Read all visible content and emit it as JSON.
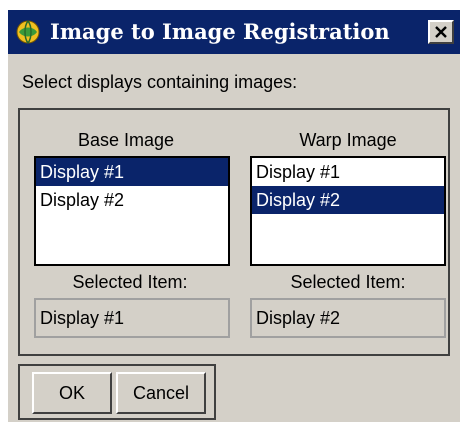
{
  "window": {
    "title": "Image to Image Registration",
    "app_icon": "globe-icon",
    "close_icon": "close-icon"
  },
  "prompt": "Select displays containing images:",
  "base": {
    "label": "Base Image",
    "items": [
      "Display #1",
      "Display #2"
    ],
    "selected_index": 0,
    "selected_label": "Selected Item:",
    "selected_value": "Display #1"
  },
  "warp": {
    "label": "Warp Image",
    "items": [
      "Display #1",
      "Display #2"
    ],
    "selected_index": 1,
    "selected_label": "Selected Item:",
    "selected_value": "Display #2"
  },
  "buttons": {
    "ok": "OK",
    "cancel": "Cancel"
  },
  "colors": {
    "titlebar": "#0a246a",
    "selection": "#0a246a",
    "dialog_bg": "#d4d0c8"
  }
}
